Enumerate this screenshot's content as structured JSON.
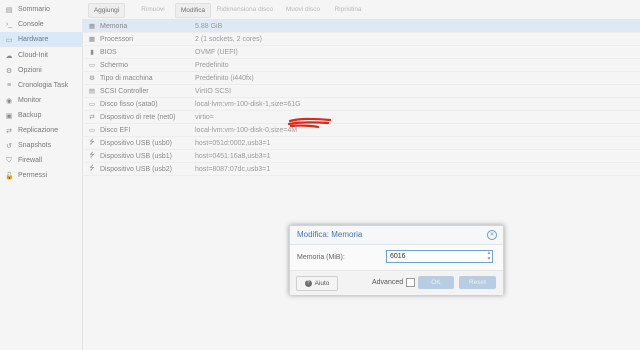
{
  "sidebar": {
    "items": [
      {
        "label": "Sommario",
        "icon": "book-icon",
        "glyph": "▤"
      },
      {
        "label": "Console",
        "icon": "terminal-icon",
        "glyph": "›_"
      },
      {
        "label": "Hardware",
        "icon": "desktop-icon",
        "glyph": "▭"
      },
      {
        "label": "Cloud-Init",
        "icon": "cloud-icon",
        "glyph": "☁"
      },
      {
        "label": "Opzioni",
        "icon": "gear-icon",
        "glyph": "⚙"
      },
      {
        "label": "Cronologia Task",
        "icon": "list-icon",
        "glyph": "≡"
      },
      {
        "label": "Monitor",
        "icon": "eye-icon",
        "glyph": "◉"
      },
      {
        "label": "Backup",
        "icon": "floppy-icon",
        "glyph": "▣"
      },
      {
        "label": "Replicazione",
        "icon": "retweet-icon",
        "glyph": "⇄"
      },
      {
        "label": "Snapshots",
        "icon": "history-icon",
        "glyph": "↺"
      },
      {
        "label": "Firewall",
        "icon": "shield-icon",
        "glyph": "⛉"
      },
      {
        "label": "Permessi",
        "icon": "unlock-icon",
        "glyph": "🔓"
      }
    ],
    "active": 2
  },
  "toolbar": {
    "add": "Aggiungi",
    "remove": "Rimuovi",
    "edit": "Modifica",
    "resize": "Ridimensiona disco",
    "move": "Muovi disco",
    "revert": "Ripristina"
  },
  "hardware": [
    {
      "name": "Memoria",
      "value": "5.88 GiB",
      "icon": "memory-icon",
      "glyph": "▦"
    },
    {
      "name": "Processori",
      "value": "2 (1 sockets, 2 cores)",
      "icon": "cpu-icon",
      "glyph": "▩"
    },
    {
      "name": "BIOS",
      "value": "OVMF (UEFI)",
      "icon": "microchip-icon",
      "glyph": "▮"
    },
    {
      "name": "Schermo",
      "value": "Predefinito",
      "icon": "monitor-icon",
      "glyph": "▭"
    },
    {
      "name": "Tipo di macchina",
      "value": "Predefinito (i440fx)",
      "icon": "cogs-icon",
      "glyph": "⚙"
    },
    {
      "name": "SCSI Controller",
      "value": "VirtIO SCSI",
      "icon": "database-icon",
      "glyph": "▤"
    },
    {
      "name": "Disco fisso (sata0)",
      "value": "local-lvm:vm-100-disk-1,size=61G",
      "icon": "hdd-icon",
      "glyph": "▭"
    },
    {
      "name": "Dispositivo di rete (net0)",
      "value": "virtio=",
      "icon": "exchange-icon",
      "glyph": "⇄"
    },
    {
      "name": "Disco EFI",
      "value": "local-lvm:vm-100-disk-0,size=4M",
      "icon": "hdd-icon",
      "glyph": "▭"
    },
    {
      "name": "Dispositivo USB (usb0)",
      "value": "host=051d:0002,usb3=1",
      "icon": "usb-icon",
      "glyph": "⭍"
    },
    {
      "name": "Dispositivo USB (usb1)",
      "value": "host=0451:16a8,usb3=1",
      "icon": "usb-icon",
      "glyph": "⭍"
    },
    {
      "name": "Dispositivo USB (usb2)",
      "value": "host=8087:07dc,usb3=1",
      "icon": "usb-icon",
      "glyph": "⭍"
    }
  ],
  "selected_row": 0,
  "dialog": {
    "title": "Modifica: Memoria",
    "field_label": "Memoria (MiB):",
    "field_value": "6016",
    "help": "Aiuto",
    "advanced": "Advanced",
    "ok": "OK",
    "reset": "Reset"
  },
  "colors": {
    "redaction": "#e0281a",
    "selected_row": "#dfe9f5",
    "dialog_title": "#4a77a8"
  }
}
